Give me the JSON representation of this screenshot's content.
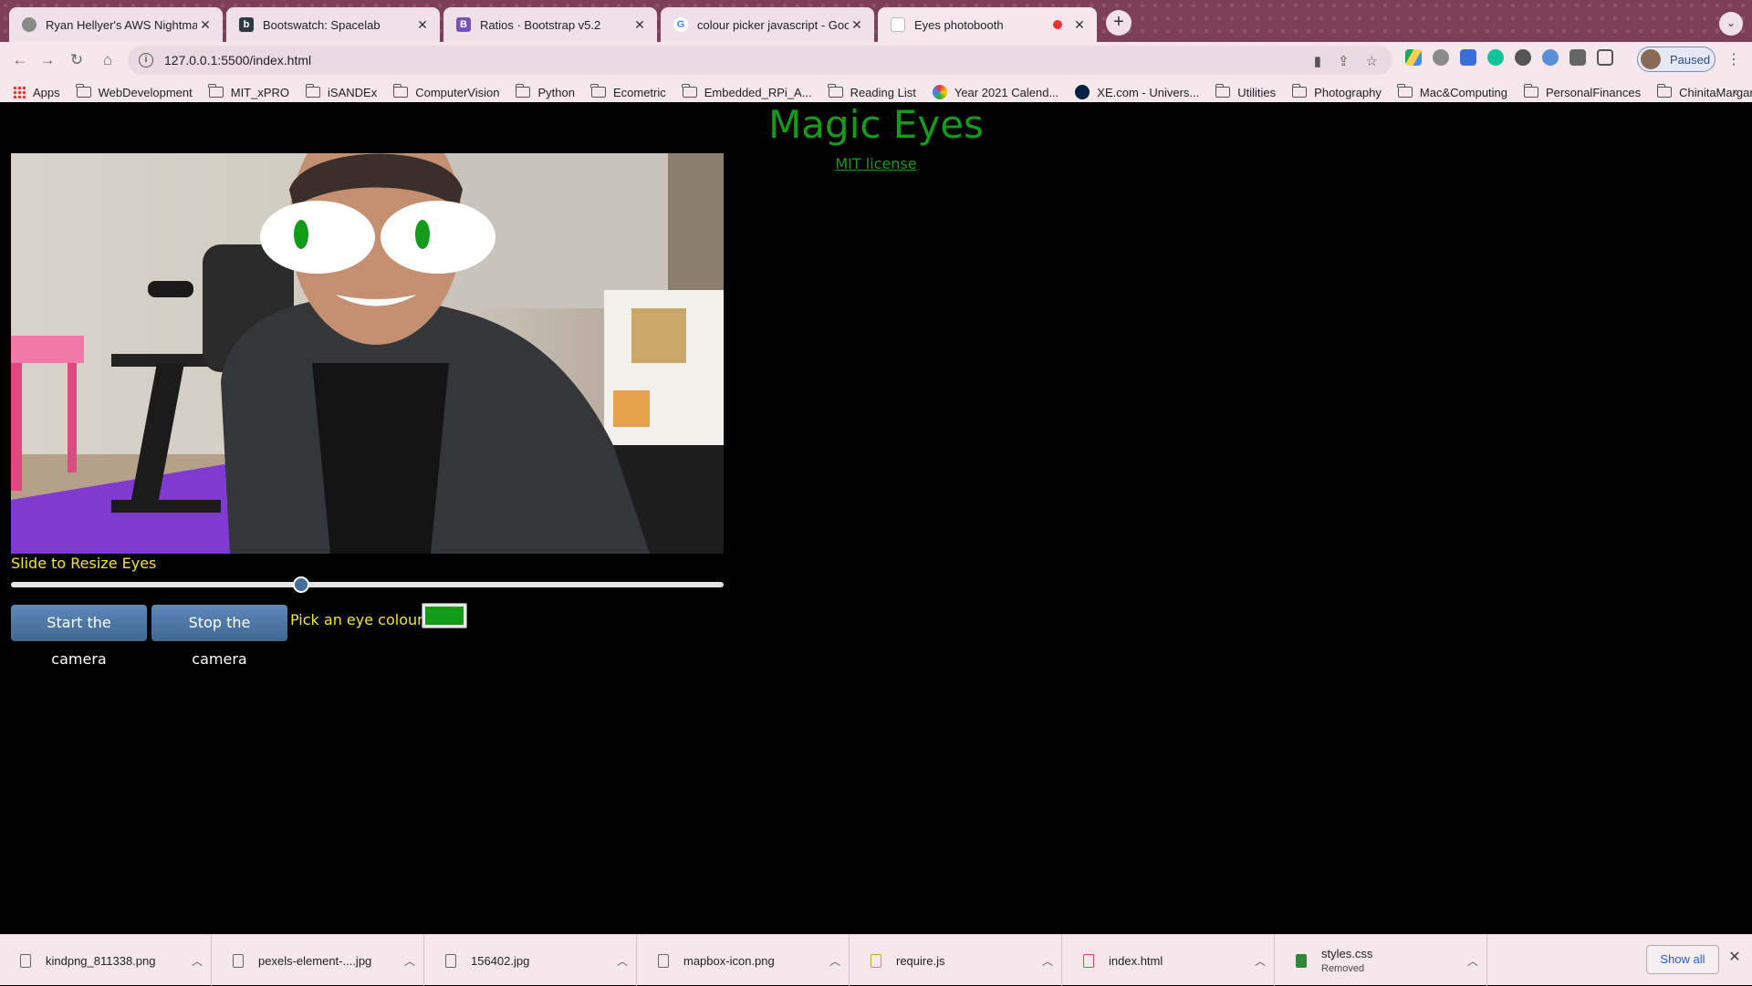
{
  "browser": {
    "tabs": [
      {
        "title": "Ryan Hellyer's AWS Nightmare",
        "favicon_color": "#8a8a8a"
      },
      {
        "title": "Bootswatch: Spacelab",
        "favicon_color": "#2e3a48",
        "favicon_letter": "b"
      },
      {
        "title": "Ratios · Bootstrap v5.2",
        "favicon_color": "#7952b3",
        "favicon_letter": "B"
      },
      {
        "title": "colour picker javascript - Goog",
        "favicon_color": "#4285f4",
        "favicon_letter": "G"
      },
      {
        "title": "Eyes photobooth",
        "favicon_color": "#c7c7c7",
        "recording": true
      }
    ],
    "address": "127.0.0.1:5500/index.html",
    "profile_label": "Paused",
    "bookmarks": [
      {
        "label": "Apps",
        "icon": "apps-grid-icon"
      },
      {
        "label": "WebDevelopment",
        "icon": "folder-icon"
      },
      {
        "label": "MIT_xPRO",
        "icon": "folder-icon"
      },
      {
        "label": "iSANDEx",
        "icon": "folder-icon"
      },
      {
        "label": "ComputerVision",
        "icon": "folder-icon"
      },
      {
        "label": "Python",
        "icon": "folder-icon"
      },
      {
        "label": "Ecometric",
        "icon": "folder-icon"
      },
      {
        "label": "Embedded_RPi_A...",
        "icon": "folder-icon"
      },
      {
        "label": "Reading List",
        "icon": "folder-icon"
      },
      {
        "label": "Year 2021 Calend...",
        "icon": "calendar-site-icon"
      },
      {
        "label": "XE.com - Univers...",
        "icon": "xe-site-icon"
      },
      {
        "label": "Utilities",
        "icon": "folder-icon"
      },
      {
        "label": "Photography",
        "icon": "folder-icon"
      },
      {
        "label": "Mac&Computing",
        "icon": "folder-icon"
      },
      {
        "label": "PersonalFinances",
        "icon": "folder-icon"
      },
      {
        "label": "ChinitaMargarita",
        "icon": "folder-icon"
      }
    ]
  },
  "page": {
    "title": "Magic Eyes",
    "license_link": "MIT license",
    "slider_label": "Slide to Resize Eyes",
    "slider_value": 0.405,
    "start_button": "Start the camera",
    "stop_button": "Stop the camera",
    "pick_label": "Pick an eye colour:",
    "eye_colour": "#139c1a",
    "text_colour": "#f6e51e",
    "button_colour": "#446e9b"
  },
  "downloads": {
    "items": [
      {
        "name": "kindpng_811338.png"
      },
      {
        "name": "pexels-element-....jpg"
      },
      {
        "name": "156402.jpg"
      },
      {
        "name": "mapbox-icon.png"
      },
      {
        "name": "require.js"
      },
      {
        "name": "index.html"
      },
      {
        "name": "styles.css",
        "status": "Removed"
      }
    ],
    "show_all": "Show all"
  }
}
